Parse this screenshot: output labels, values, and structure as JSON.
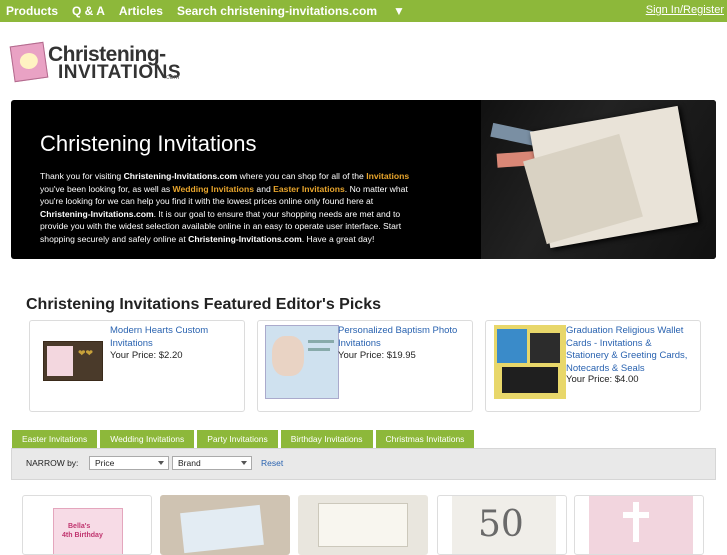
{
  "nav": {
    "items": [
      "Products",
      "Q & A",
      "Articles",
      "Search christening-invitations.com"
    ],
    "sign_in": "Sign In/Register"
  },
  "logo": {
    "line1": "Christening-",
    "line2": "INVITATIONS",
    "suffix": ".com"
  },
  "hero": {
    "title": "Christening Invitations",
    "p1": "Thank you for visiting ",
    "site1": "Christening-Invitations.com",
    "p2": " where you can shop for all of the ",
    "link_invitations": "Invitations",
    "p3": " you've been looking for, as well as ",
    "link_wedding": "Wedding Invitations",
    "p4": " and ",
    "link_easter": "Easter Invitations",
    "p5": ". No matter what you're looking for we can help you find it with the lowest prices online only found here at ",
    "site2": "Christening-Invitations.com",
    "p6": ". It is our goal to ensure that your shopping needs are met and to provide you with the widest selection available online in an easy to operate user interface. Start shopping securely and safely online at ",
    "site3": "Christening-Invitations.com",
    "p7": ". Have a great day!"
  },
  "featured": {
    "title": "Christening Invitations Featured Editor's Picks",
    "items": [
      {
        "title": "Modern Hearts Custom Invitations",
        "price": "Your Price: $2.20"
      },
      {
        "title": "Personalized Baptism Photo Invitations",
        "price": "Your Price: $19.95"
      },
      {
        "title": "Graduation Religious Wallet Cards - Invitations & Stationery & Greeting Cards, Notecards & Seals",
        "price": "Your Price: $4.00"
      }
    ]
  },
  "tabs": [
    "Easter Invitations",
    "Wedding Invitations",
    "Party Invitations",
    "Birthday Invitations",
    "Christmas Invitations"
  ],
  "filter": {
    "label": "NARROW by:",
    "price_select": "Price",
    "brand_select": "Brand",
    "reset": "Reset"
  },
  "products": {
    "p1_line1": "Bella's",
    "p1_line2": "4th Birthday",
    "p4_text": "50"
  },
  "colors": {
    "accent_green": "#8db83a",
    "link_blue": "#2a63b0",
    "highlight_orange": "#e8a52c"
  }
}
